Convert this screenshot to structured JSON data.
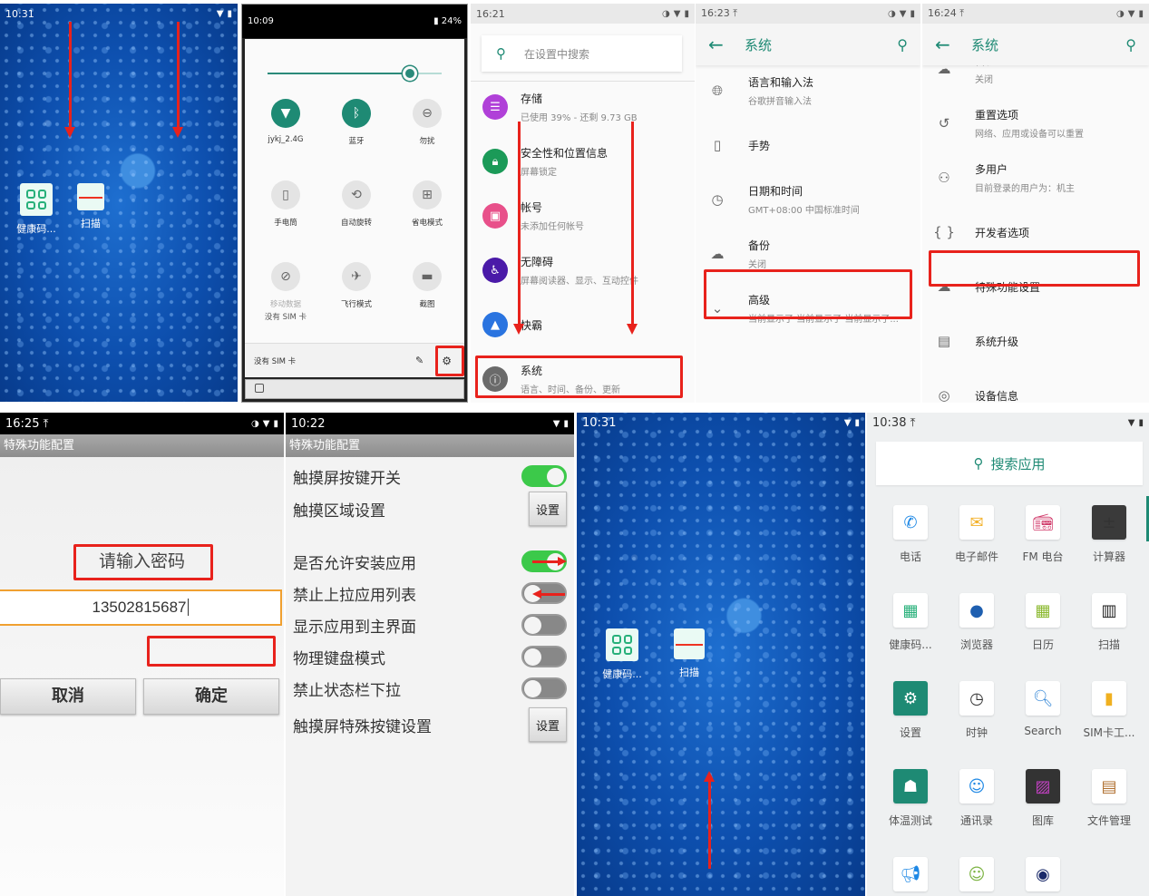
{
  "colors": {
    "accent_teal": "#1e8a74",
    "highlight_red": "#e8221c",
    "toggle_on": "#3cc94a",
    "input_border": "#f0a030"
  },
  "panel1_home": {
    "time": "10:31",
    "status_icons": [
      "wifi-icon",
      "battery-icon"
    ],
    "apps": [
      {
        "label": "健康码...",
        "icon": "health-code-icon"
      },
      {
        "label": "扫描",
        "icon": "barcode-scan-icon"
      }
    ],
    "gesture": "swipe-down"
  },
  "panel2_quick_settings": {
    "time": "10:09",
    "battery": "24%",
    "brightness_level": 0.82,
    "tiles": [
      {
        "label": "jykj_2.4G",
        "icon": "wifi-icon",
        "state": "on"
      },
      {
        "label": "蓝牙",
        "icon": "bluetooth-icon",
        "state": "on"
      },
      {
        "label": "勿扰",
        "icon": "do-not-disturb-icon",
        "state": "off"
      },
      {
        "label": "手电筒",
        "icon": "flashlight-icon",
        "state": "off"
      },
      {
        "label": "自动旋转",
        "icon": "auto-rotate-icon",
        "state": "off"
      },
      {
        "label": "省电模式",
        "icon": "battery-saver-icon",
        "state": "off"
      },
      {
        "label": "移动数据",
        "sublabel": "没有 SIM 卡",
        "icon": "mobile-data-icon",
        "state": "disabled"
      },
      {
        "label": "飞行模式",
        "icon": "airplane-icon",
        "state": "off"
      },
      {
        "label": "截图",
        "icon": "screenshot-icon",
        "state": "off"
      }
    ],
    "footer_text": "没有 SIM 卡",
    "edit_icon": "pencil-icon",
    "settings_icon": "gear-icon"
  },
  "panel3_settings": {
    "time": "16:21",
    "search_placeholder": "在设置中搜索",
    "items": [
      {
        "title": "存储",
        "subtitle": "已使用 39% - 还剩 9.73 GB",
        "icon": "storage-icon",
        "color": "#b040d8"
      },
      {
        "title": "安全性和位置信息",
        "subtitle": "屏幕锁定",
        "icon": "lock-icon",
        "color": "#1b9a58"
      },
      {
        "title": "帐号",
        "subtitle": "未添加任何帐号",
        "icon": "account-icon",
        "color": "#e8508a"
      },
      {
        "title": "无障碍",
        "subtitle": "屏幕阅读器、显示、互动控件",
        "icon": "accessibility-icon",
        "color": "#4a1aa8"
      },
      {
        "title": "快霸",
        "subtitle": "",
        "icon": "rocket-icon",
        "color": "#2a74e0"
      },
      {
        "title": "系统",
        "subtitle": "语言、时间、备份、更新",
        "icon": "info-icon",
        "color": "#6a6a6a"
      }
    ]
  },
  "panel4_system": {
    "time": "16:23",
    "title": "系统",
    "items": [
      {
        "title": "语言和输入法",
        "subtitle": "谷歌拼音输入法",
        "icon": "globe-icon"
      },
      {
        "title": "手势",
        "subtitle": "",
        "icon": "gesture-phone-icon"
      },
      {
        "title": "日期和时间",
        "subtitle": "GMT+08:00 中国标准时间",
        "icon": "clock-icon"
      },
      {
        "title": "备份",
        "subtitle": "关闭",
        "icon": "cloud-backup-icon"
      },
      {
        "title": "高级",
        "subtitle": "当前显示了 当前显示了 当前显示了...",
        "icon": "chevron-down-icon"
      }
    ]
  },
  "panel5_system_advanced": {
    "time": "16:24",
    "title": "系统",
    "items": [
      {
        "title": "备份",
        "subtitle": "关闭",
        "icon": "cloud-backup-icon"
      },
      {
        "title": "重置选项",
        "subtitle": "网络、应用或设备可以重置",
        "icon": "history-icon"
      },
      {
        "title": "多用户",
        "subtitle": "目前登录的用户为：机主",
        "icon": "person-icon"
      },
      {
        "title": "开发者选项",
        "subtitle": "",
        "icon": "braces-icon"
      },
      {
        "title": "特殊功能设置",
        "subtitle": "",
        "icon": "cloud-settings-icon"
      },
      {
        "title": "系统升级",
        "subtitle": "",
        "icon": "system-update-icon"
      },
      {
        "title": "设备信息",
        "subtitle": "",
        "icon": "device-info-icon"
      }
    ]
  },
  "panel6_password": {
    "time": "16:25",
    "title": "特殊功能配置",
    "prompt": "请输入密码",
    "password_value": "13502815687",
    "cancel_label": "取消",
    "confirm_label": "确定"
  },
  "panel7_special_config": {
    "time": "10:22",
    "title": "特殊功能配置",
    "rows": [
      {
        "label": "触摸屏按键开关",
        "type": "toggle",
        "on": true
      },
      {
        "label": "触摸区域设置",
        "type": "button",
        "button_label": "设置"
      },
      {
        "label": "是否允许安装应用",
        "type": "toggle",
        "on": true
      },
      {
        "label": "禁止上拉应用列表",
        "type": "toggle",
        "on": false
      },
      {
        "label": "显示应用到主界面",
        "type": "toggle",
        "on": false
      },
      {
        "label": "物理键盘模式",
        "type": "toggle",
        "on": false
      },
      {
        "label": "禁止状态栏下拉",
        "type": "toggle",
        "on": false
      },
      {
        "label": "触摸屏特殊按键设置",
        "type": "button",
        "button_label": "设置"
      }
    ]
  },
  "panel8_home": {
    "time": "10:31",
    "apps": [
      {
        "label": "健康码...",
        "icon": "health-code-icon"
      },
      {
        "label": "扫描",
        "icon": "barcode-scan-icon"
      }
    ],
    "gesture": "swipe-up"
  },
  "panel9_drawer": {
    "time": "10:38",
    "search_label": "搜索应用",
    "apps": [
      {
        "label": "电话",
        "icon": "phone-icon"
      },
      {
        "label": "电子邮件",
        "icon": "email-icon"
      },
      {
        "label": "FM 电台",
        "icon": "radio-icon"
      },
      {
        "label": "计算器",
        "icon": "calculator-icon"
      },
      {
        "label": "健康码...",
        "icon": "health-code-icon"
      },
      {
        "label": "浏览器",
        "icon": "globe-browser-icon"
      },
      {
        "label": "日历",
        "icon": "calendar-icon"
      },
      {
        "label": "扫描",
        "icon": "barcode-scan-icon"
      },
      {
        "label": "设置",
        "icon": "settings-gear-icon"
      },
      {
        "label": "时钟",
        "icon": "clock-icon"
      },
      {
        "label": "Search",
        "icon": "magnifier-icon"
      },
      {
        "label": "SIM卡工...",
        "icon": "sim-toolkit-icon"
      },
      {
        "label": "体温测试",
        "icon": "android-icon"
      },
      {
        "label": "通讯录",
        "icon": "contacts-icon"
      },
      {
        "label": "图库",
        "icon": "gallery-icon"
      },
      {
        "label": "文件管理",
        "icon": "file-manager-icon"
      },
      {
        "label": "",
        "icon": "megaphone-icon"
      },
      {
        "label": "",
        "icon": "messaging-icon"
      },
      {
        "label": "",
        "icon": "speaker-icon"
      }
    ]
  }
}
